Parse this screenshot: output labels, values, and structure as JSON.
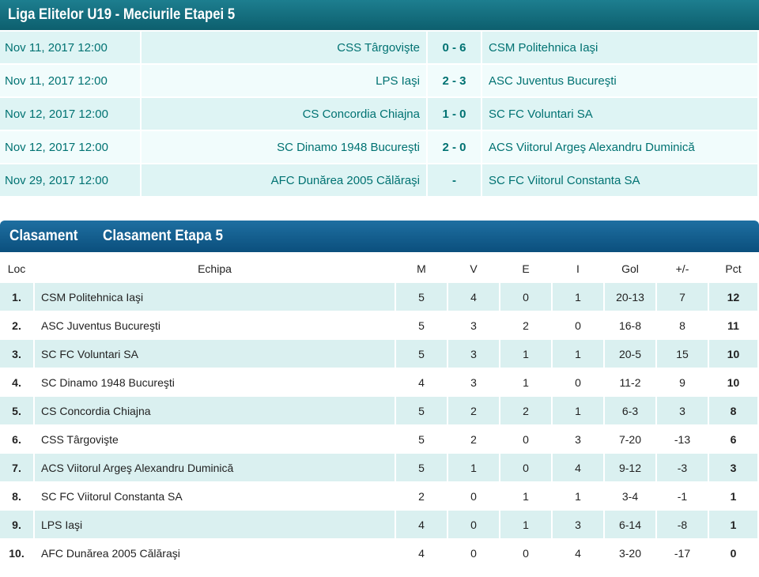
{
  "matches": {
    "title": "Liga Elitelor U19 - Meciurile Etapei 5",
    "rows": [
      {
        "date": "Nov 11, 2017 12:00",
        "home": "CSS Târgovişte",
        "score": "0 - 6",
        "away": "CSM Politehnica Iaşi"
      },
      {
        "date": "Nov 11, 2017 12:00",
        "home": "LPS Iaşi",
        "score": "2 - 3",
        "away": "ASC Juventus Bucureşti"
      },
      {
        "date": "Nov 12, 2017 12:00",
        "home": "CS Concordia Chiajna",
        "score": "1 - 0",
        "away": "SC FC Voluntari SA"
      },
      {
        "date": "Nov 12, 2017 12:00",
        "home": "SC Dinamo 1948 Bucureşti",
        "score": "2 - 0",
        "away": "ACS Viitorul Argeş Alexandru Duminică"
      },
      {
        "date": "Nov 29, 2017 12:00",
        "home": "AFC Dunărea 2005 Călăraşi",
        "score": "-",
        "away": "SC FC Viitorul Constanta SA"
      }
    ]
  },
  "standings": {
    "title": "Clasament",
    "subtitle": "Clasament Etapa 5",
    "columns": {
      "loc": "Loc",
      "team": "Echipa",
      "m": "M",
      "v": "V",
      "e": "E",
      "i": "I",
      "gol": "Gol",
      "dif": "+/-",
      "pct": "Pct"
    },
    "rows": [
      {
        "loc": "1.",
        "team": "CSM Politehnica Iaşi",
        "m": "5",
        "v": "4",
        "e": "0",
        "i": "1",
        "gol": "20-13",
        "dif": "7",
        "pct": "12"
      },
      {
        "loc": "2.",
        "team": "ASC Juventus Bucureşti",
        "m": "5",
        "v": "3",
        "e": "2",
        "i": "0",
        "gol": "16-8",
        "dif": "8",
        "pct": "11"
      },
      {
        "loc": "3.",
        "team": "SC FC Voluntari SA",
        "m": "5",
        "v": "3",
        "e": "1",
        "i": "1",
        "gol": "20-5",
        "dif": "15",
        "pct": "10"
      },
      {
        "loc": "4.",
        "team": "SC Dinamo 1948 Bucureşti",
        "m": "4",
        "v": "3",
        "e": "1",
        "i": "0",
        "gol": "11-2",
        "dif": "9",
        "pct": "10"
      },
      {
        "loc": "5.",
        "team": "CS Concordia Chiajna",
        "m": "5",
        "v": "2",
        "e": "2",
        "i": "1",
        "gol": "6-3",
        "dif": "3",
        "pct": "8"
      },
      {
        "loc": "6.",
        "team": "CSS Târgovişte",
        "m": "5",
        "v": "2",
        "e": "0",
        "i": "3",
        "gol": "7-20",
        "dif": "-13",
        "pct": "6"
      },
      {
        "loc": "7.",
        "team": "ACS Viitorul Argeş Alexandru Duminică",
        "m": "5",
        "v": "1",
        "e": "0",
        "i": "4",
        "gol": "9-12",
        "dif": "-3",
        "pct": "3"
      },
      {
        "loc": "8.",
        "team": "SC FC Viitorul Constanta SA",
        "m": "2",
        "v": "0",
        "e": "1",
        "i": "1",
        "gol": "3-4",
        "dif": "-1",
        "pct": "1"
      },
      {
        "loc": "9.",
        "team": "LPS Iaşi",
        "m": "4",
        "v": "0",
        "e": "1",
        "i": "3",
        "gol": "6-14",
        "dif": "-8",
        "pct": "1"
      },
      {
        "loc": "10.",
        "team": "AFC Dunărea 2005 Călăraşi",
        "m": "4",
        "v": "0",
        "e": "0",
        "i": "4",
        "gol": "3-20",
        "dif": "-17",
        "pct": "0"
      }
    ]
  },
  "colors": {
    "matches_header": "#0d5f6e",
    "standings_header": "#0b4f7d",
    "match_text": "#007272",
    "row_alt": "#daf0f0"
  }
}
